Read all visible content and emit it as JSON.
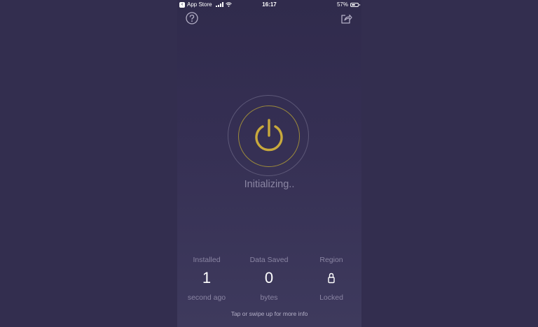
{
  "status_bar": {
    "back_app": "App Store",
    "time": "16:17",
    "battery_percent": "57%",
    "battery_level": 0.57
  },
  "header": {
    "help_icon": "question-circle-icon",
    "share_icon": "share-icon"
  },
  "main": {
    "power_icon": "power-icon",
    "status": "Initializing..",
    "accent_color": "#c8a93c"
  },
  "stats": [
    {
      "label": "Installed",
      "value": "1",
      "sub": "second ago"
    },
    {
      "label": "Data Saved",
      "value": "0",
      "sub": "bytes"
    },
    {
      "label": "Region",
      "value_icon": "lock-icon",
      "sub": "Locked"
    }
  ],
  "footer": {
    "hint": "Tap or swipe up for more info"
  }
}
